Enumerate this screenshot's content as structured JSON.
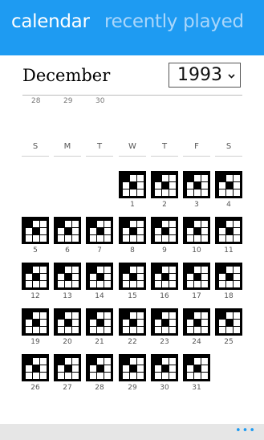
{
  "header": {
    "tabs": [
      {
        "label": "calendar"
      },
      {
        "label": "recently played"
      }
    ]
  },
  "calendar": {
    "month": "December",
    "year": "1993",
    "previous_month_days": [
      "28",
      "29",
      "30"
    ],
    "weekdays": [
      "S",
      "M",
      "T",
      "W",
      "T",
      "F",
      "S"
    ],
    "first_weekday_index": 3,
    "days": [
      "1",
      "2",
      "3",
      "4",
      "5",
      "6",
      "7",
      "8",
      "9",
      "10",
      "11",
      "12",
      "13",
      "14",
      "15",
      "16",
      "17",
      "18",
      "19",
      "20",
      "21",
      "22",
      "23",
      "24",
      "25",
      "26",
      "27",
      "28",
      "29",
      "30",
      "31"
    ],
    "tile_icon": "puzzle-grid-icon"
  },
  "appbar": {
    "more_icon": "ellipsis-icon",
    "more_label": "•••"
  },
  "colors": {
    "accent": "#1e9bf2",
    "inactive_tab": "#a9d6fb",
    "appbar": "#e6e6e6"
  }
}
